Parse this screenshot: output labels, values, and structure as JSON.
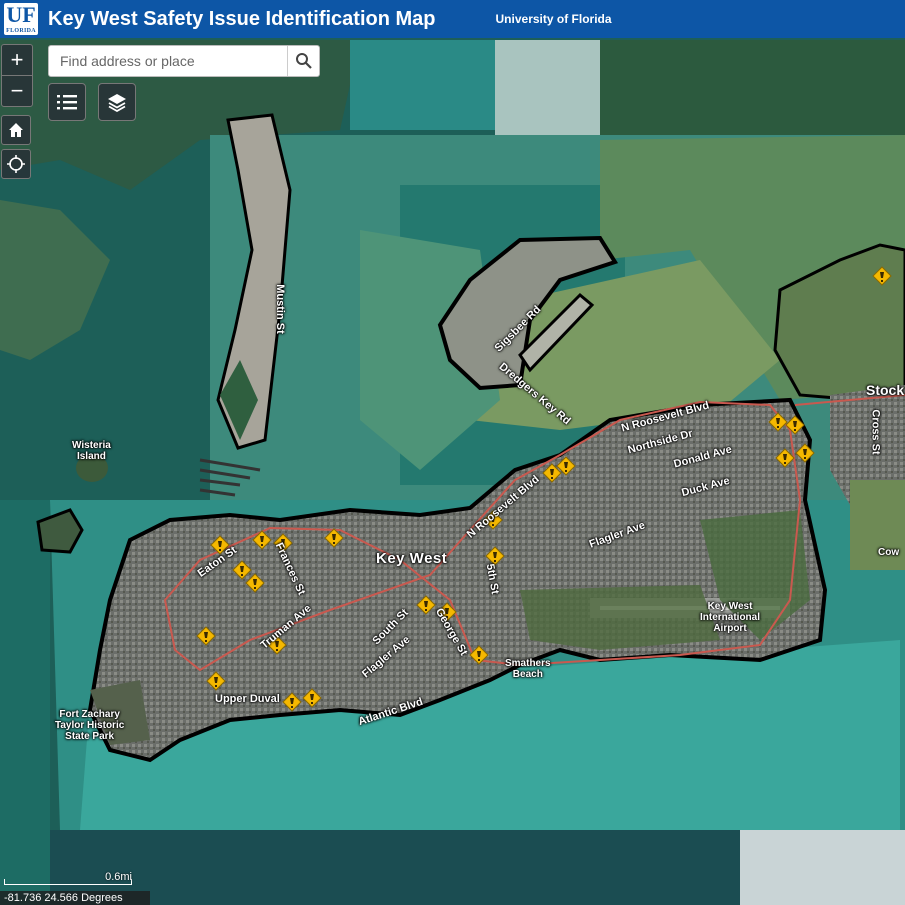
{
  "header": {
    "logo_text": "UF",
    "logo_subtext": "FLORIDA",
    "title": "Key West Safety Issue Identification Map",
    "organization": "University of Florida"
  },
  "controls": {
    "zoom_in": "+",
    "zoom_out": "−",
    "legend_icon": "list-icon",
    "layers_icon": "layers-icon",
    "home_icon": "home-icon",
    "locate_icon": "locate-icon"
  },
  "search": {
    "placeholder": "Find address or place",
    "value": "",
    "icon": "search-icon"
  },
  "map_labels": {
    "key_west": "Key West",
    "wisteria_island": "Wisteria\nIsland",
    "sigsbee_rd": "Sigsbee Rd",
    "mustin_st": "Mustin St",
    "dredgers_key_rd": "Dredgers Key Rd",
    "n_roosevelt_blvd_1": "N Roosevelt Blvd",
    "n_roosevelt_blvd_2": "N Roosevelt Blvd",
    "northside_dr": "Northside Dr",
    "donald_ave": "Donald Ave",
    "duck_ave": "Duck Ave",
    "flagler_ave_1": "Flagler Ave",
    "flagler_ave_2": "Flagler Ave",
    "eaton_st": "Eaton St",
    "frances_st": "Frances St",
    "truman_ave": "Truman Ave",
    "south_st": "South St",
    "george_st": "George St",
    "fifth_st": "5th St",
    "upper_duval": "Upper Duval",
    "atlantic_blvd": "Atlantic Blvd",
    "smathers_beach": "Smathers\nBeach",
    "key_west_airport": "Key West\nInternational\nAirport",
    "fort_zachary": "Fort Zachary\nTaylor Historic\nState Park",
    "stock": "Stock",
    "cross_st": "Cross St",
    "cow": "Cow"
  },
  "markers": {
    "type": "safety-issue-warning-icon",
    "color": "#f5b800"
  },
  "colors": {
    "header": "#0d56a6",
    "route_line": "#c9594f",
    "boundary": "#000000"
  },
  "scale_bar": {
    "label": "0.6mi"
  },
  "coordinates": {
    "text": "-81.736 24.566 Degrees"
  }
}
